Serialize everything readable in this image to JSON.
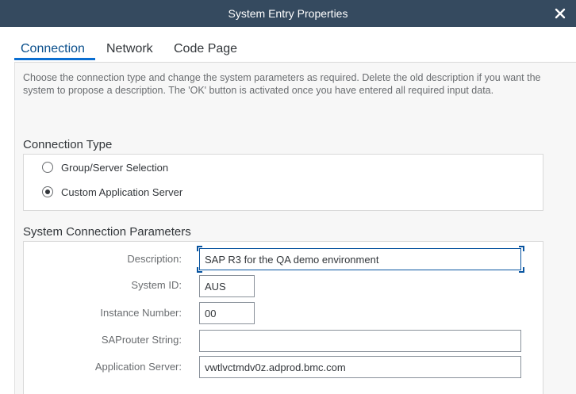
{
  "window": {
    "title": "System Entry Properties"
  },
  "tabs": [
    {
      "label": "Connection",
      "active": true
    },
    {
      "label": "Network",
      "active": false
    },
    {
      "label": "Code Page",
      "active": false
    }
  ],
  "intro_text": "Choose the connection type and change the system parameters as required. Delete the old description if you want the system to propose a description. The 'OK' button is activated once you have entered all required input data.",
  "connection_type": {
    "title": "Connection Type",
    "options": [
      {
        "label": "Group/Server Selection",
        "selected": false
      },
      {
        "label": "Custom Application Server",
        "selected": true
      }
    ]
  },
  "parameters": {
    "title": "System Connection Parameters",
    "fields": [
      {
        "label": "Description:",
        "value": "SAP R3 for the QA demo environment"
      },
      {
        "label": "System ID:",
        "value": "AUS"
      },
      {
        "label": "Instance Number:",
        "value": "00"
      },
      {
        "label": "SAProuter String:",
        "value": ""
      },
      {
        "label": "Application Server:",
        "value": "vwtlvctmdv0z.adprod.bmc.com"
      }
    ]
  },
  "colors": {
    "titlebar": "#354a5f",
    "accent": "#0a6ed1",
    "active_tab_text": "#0a4f8c",
    "panel_bg": "#f7f7f7"
  },
  "icons": {
    "close": "close-icon"
  }
}
